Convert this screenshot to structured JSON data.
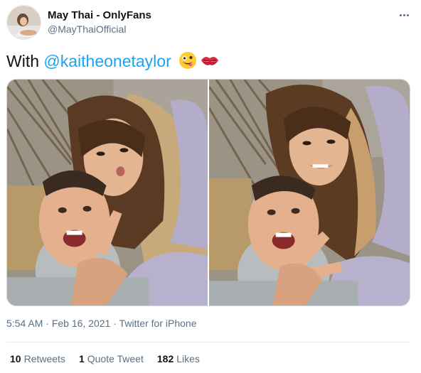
{
  "author": {
    "name": "May Thai - OnlyFans",
    "handle": "@MayThaiOfficial"
  },
  "tweet": {
    "prefix": "With ",
    "mention": "@kaitheonetaylor",
    "emojis": [
      "zany-face-emoji",
      "kiss-mark-emoji"
    ]
  },
  "media": [
    {
      "description_icon": "photo"
    },
    {
      "description_icon": "photo"
    }
  ],
  "meta": {
    "time": "5:54 AM",
    "separator": " · ",
    "date": "Feb 16, 2021",
    "source": "Twitter for iPhone"
  },
  "stats": {
    "retweets_count": "10",
    "retweets_label": "Retweets",
    "quotes_count": "1",
    "quotes_label": "Quote Tweet",
    "likes_count": "182",
    "likes_label": "Likes"
  },
  "colors": {
    "link": "#1da1f2",
    "secondary_text": "#5b7083",
    "primary_text": "#0f1419"
  }
}
